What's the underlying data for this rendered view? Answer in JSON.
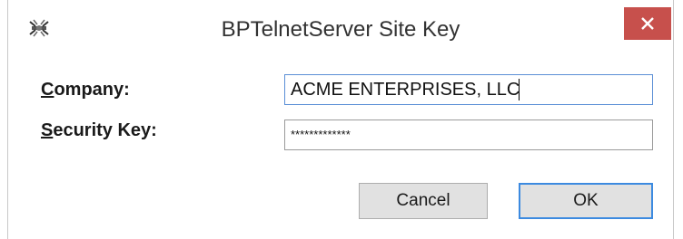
{
  "window": {
    "title": "BPTelnetServer Site Key",
    "close_glyph": "✕"
  },
  "form": {
    "company_label_accel": "C",
    "company_label_rest": "ompany:",
    "company_value": "ACME ENTERPRISES, LLC",
    "key_label_accel": "S",
    "key_label_rest": "ecurity Key:",
    "key_value": "*************"
  },
  "buttons": {
    "cancel": "Cancel",
    "ok": "OK"
  },
  "icons": {
    "app": "telnet-plug-icon",
    "close": "close-icon"
  },
  "colors": {
    "close_bg": "#c7504c",
    "focus_border": "#3c8ae0"
  }
}
